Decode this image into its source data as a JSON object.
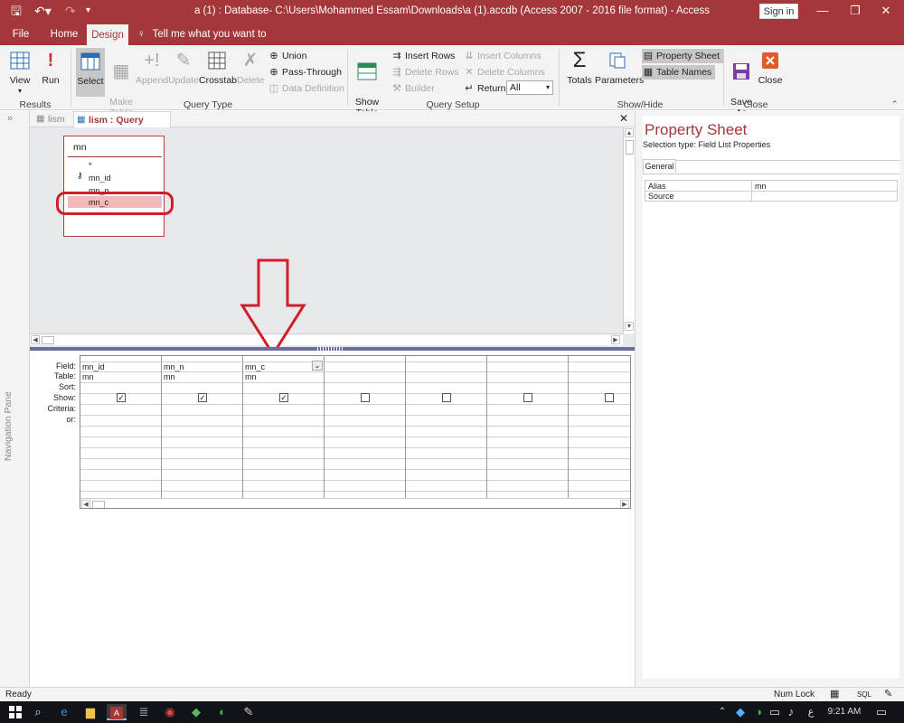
{
  "window": {
    "title": "a (1) : Database- C:\\Users\\Mohammed Essam\\Downloads\\a (1).accdb (Access 2007 - 2016 file format)  -  Access",
    "signin": "Sign in",
    "accent": "#a4373a"
  },
  "menu": {
    "file": "File",
    "home": "Home",
    "design": "Design",
    "tell_me": "Tell me what you want to do"
  },
  "ribbon": {
    "results": {
      "view": "View",
      "run": "Run",
      "label": "Results"
    },
    "query_type": {
      "select": "Select",
      "make_table": "Make\nTable",
      "append": "Append",
      "update": "Update",
      "crosstab": "Crosstab",
      "delete": "Delete",
      "union": "Union",
      "pass_through": "Pass-Through",
      "data_definition": "Data Definition",
      "label": "Query Type"
    },
    "query_setup": {
      "show_table": "Show\nTable",
      "insert_rows": "Insert Rows",
      "delete_rows": "Delete Rows",
      "builder": "Builder",
      "insert_columns": "Insert Columns",
      "delete_columns": "Delete Columns",
      "return_label": "Return:",
      "return_value": "All",
      "label": "Query Setup"
    },
    "show_hide": {
      "totals": "Totals",
      "parameters": "Parameters",
      "property_sheet": "Property Sheet",
      "table_names": "Table Names",
      "label": "Show/Hide"
    },
    "close_group": {
      "save_as": "Save\nAs",
      "close": "Close",
      "label": "Close"
    }
  },
  "doc_tabs": [
    {
      "label": "lism"
    },
    {
      "label": "lism : Query Builder"
    }
  ],
  "field_list": {
    "title": "mn",
    "items": [
      "*",
      "mn_id",
      "mn_n",
      "mn_c"
    ]
  },
  "grid": {
    "row_labels": [
      "Field:",
      "Table:",
      "Sort:",
      "Show:",
      "Criteria:",
      "or:"
    ],
    "columns": [
      {
        "field": "mn_id",
        "table": "mn",
        "show": true
      },
      {
        "field": "mn_n",
        "table": "mn",
        "show": true
      },
      {
        "field": "mn_c",
        "table": "mn",
        "show": true
      },
      {
        "field": "",
        "table": "",
        "show": false
      },
      {
        "field": "",
        "table": "",
        "show": false
      },
      {
        "field": "",
        "table": "",
        "show": false
      },
      {
        "field": "",
        "table": "",
        "show": false
      }
    ]
  },
  "nav_pane": {
    "label": "Navigation Pane"
  },
  "property_sheet": {
    "title": "Property Sheet",
    "selection_type": "Selection type:  Field List Properties",
    "tab": "General",
    "rows": [
      {
        "name": "Alias",
        "value": "mn"
      },
      {
        "name": "Source",
        "value": ""
      }
    ]
  },
  "status": {
    "ready": "Ready",
    "num_lock": "Num Lock",
    "sql": "SQL"
  },
  "taskbar": {
    "time": "9:21 AM",
    "lang": "ع"
  }
}
